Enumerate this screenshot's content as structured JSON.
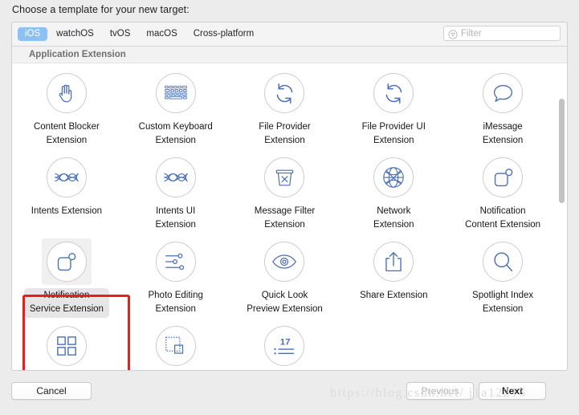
{
  "dialog": {
    "title": "Choose a template for your new target:"
  },
  "toolbar": {
    "tabs": [
      {
        "label": "iOS",
        "active": true
      },
      {
        "label": "watchOS",
        "active": false
      },
      {
        "label": "tvOS",
        "active": false
      },
      {
        "label": "macOS",
        "active": false
      },
      {
        "label": "Cross-platform",
        "active": false
      }
    ],
    "filter": {
      "value": "",
      "placeholder": "Filter",
      "icon": "filter-icon"
    }
  },
  "section": {
    "header": "Application Extension"
  },
  "templates": [
    {
      "label": "Content Blocker\nExtension",
      "icon": "hand-icon",
      "selected": false
    },
    {
      "label": "Custom Keyboard\nExtension",
      "icon": "keyboard-icon",
      "selected": false
    },
    {
      "label": "File Provider\nExtension",
      "icon": "refresh-icon",
      "selected": false
    },
    {
      "label": "File Provider UI\nExtension",
      "icon": "refresh-icon",
      "selected": false
    },
    {
      "label": "iMessage\nExtension",
      "icon": "speech-bubble-icon",
      "selected": false
    },
    {
      "label": "Intents Extension",
      "icon": "siri-waves-icon",
      "selected": false
    },
    {
      "label": "Intents UI\nExtension",
      "icon": "siri-waves-icon",
      "selected": false
    },
    {
      "label": "Message Filter\nExtension",
      "icon": "trash-x-icon",
      "selected": false
    },
    {
      "label": "Network\nExtension",
      "icon": "globe-icon",
      "selected": false
    },
    {
      "label": "Notification\nContent Extension",
      "icon": "notification-badge-icon",
      "selected": false
    },
    {
      "label": "Notification\nService Extension",
      "icon": "notification-badge-icon",
      "selected": true
    },
    {
      "label": "Photo Editing\nExtension",
      "icon": "sliders-icon",
      "selected": false
    },
    {
      "label": "Quick Look\nPreview Extension",
      "icon": "eye-icon",
      "selected": false
    },
    {
      "label": "Share Extension",
      "icon": "share-icon",
      "selected": false
    },
    {
      "label": "Spotlight Index\nExtension",
      "icon": "magnifier-icon",
      "selected": false
    },
    {
      "label": "",
      "icon": "grid-squares-icon",
      "selected": false
    },
    {
      "label": "",
      "icon": "dotted-square-icon",
      "selected": false
    },
    {
      "label": "",
      "icon": "today-17-icon",
      "selected": false
    },
    {
      "label": "",
      "icon": "",
      "selected": false
    },
    {
      "label": "",
      "icon": "",
      "selected": false
    }
  ],
  "footer": {
    "cancel_label": "Cancel",
    "previous_label": "Previous",
    "next_label": "Next"
  },
  "watermark": {
    "text": "https://blog.csdn.net/ j1a12216"
  },
  "colors": {
    "accent": "#8cc2f3",
    "icon_stroke": "#4a6fb5",
    "annotation": "#ee1c14",
    "selection": "#e6e6e6",
    "panel_bg": "#ffffff",
    "window_bg": "#ececec"
  }
}
